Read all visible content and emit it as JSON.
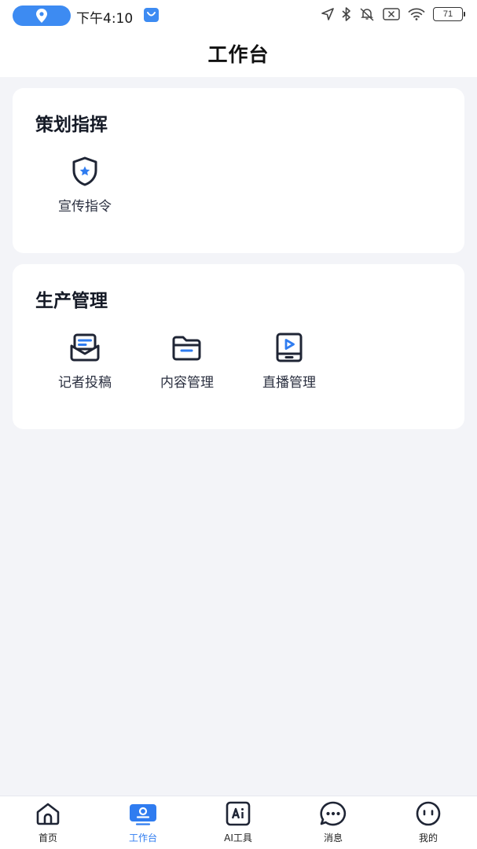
{
  "status_bar": {
    "time": "下午4:10",
    "battery": "71"
  },
  "header": {
    "title": "工作台"
  },
  "sections": [
    {
      "title": "策划指挥",
      "items": [
        {
          "label": "宣传指令",
          "icon": "shield-star-icon"
        }
      ]
    },
    {
      "title": "生产管理",
      "items": [
        {
          "label": "记者投稿",
          "icon": "mail-tray-icon"
        },
        {
          "label": "内容管理",
          "icon": "folder-icon"
        },
        {
          "label": "直播管理",
          "icon": "tablet-play-icon"
        }
      ]
    }
  ],
  "tabbar": {
    "tabs": [
      {
        "label": "首页",
        "icon": "home-icon"
      },
      {
        "label": "工作台",
        "icon": "workbench-icon",
        "active": true
      },
      {
        "label": "AI工具",
        "icon": "ai-icon"
      },
      {
        "label": "消息",
        "icon": "chat-bubble-icon"
      },
      {
        "label": "我的",
        "icon": "face-icon"
      }
    ]
  },
  "colors": {
    "accent": "#2f7cf0",
    "background": "#f3f4f8",
    "card": "#ffffff",
    "icon_stroke": "#1f2535"
  }
}
